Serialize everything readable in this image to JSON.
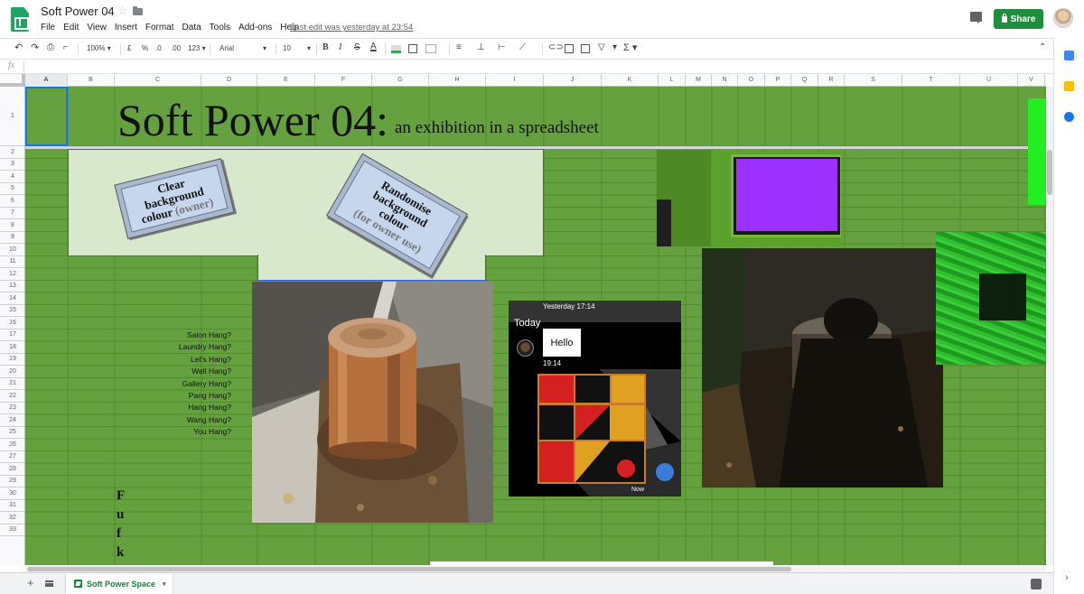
{
  "doc": {
    "title": "Soft Power 04",
    "menu": [
      "File",
      "Edit",
      "View",
      "Insert",
      "Format",
      "Data",
      "Tools",
      "Add-ons",
      "Help"
    ],
    "last_edit": "Last edit was yesterday at 23:54",
    "share_label": "Share"
  },
  "toolbar": {
    "zoom": "100%",
    "currency": "£",
    "percent": "%",
    "dec_less": ".0",
    "dec_more": ".00",
    "format_more": "123",
    "font": "Arial",
    "font_size": "10",
    "bold": "B",
    "italic": "I",
    "strike": "S",
    "text_color": "A"
  },
  "formula": {
    "fx": "fx"
  },
  "columns": [
    "A",
    "B",
    "C",
    "D",
    "E",
    "F",
    "G",
    "H",
    "I",
    "J",
    "K",
    "L",
    "M",
    "N",
    "O",
    "P",
    "Q",
    "R",
    "S",
    "T",
    "U",
    "V"
  ],
  "rows": [
    "1",
    "2",
    "3",
    "4",
    "5",
    "6",
    "7",
    "8",
    "9",
    "10",
    "11",
    "12",
    "13",
    "14",
    "15",
    "16",
    "17",
    "18",
    "19",
    "20",
    "21",
    "22",
    "23",
    "24",
    "25",
    "26",
    "27",
    "28",
    "29",
    "30",
    "31",
    "32",
    "33"
  ],
  "sheet": {
    "title_main": "Soft Power 04:",
    "title_sub": "an exhibition in a spreadsheet",
    "btn_clear": {
      "line1": "Clear",
      "line2": "background",
      "line3": "colour",
      "muted": "(owner)"
    },
    "btn_random": {
      "line1": "Randomise",
      "line2": "background",
      "line3": "colour",
      "muted": "(for owner use)"
    },
    "hang_list": [
      "Salon Hang?",
      "Laundry Hang?",
      "Let's Hang?",
      "Well Hang?",
      "Gallery Hang?",
      "Pang Hang?",
      "Hang Hang?",
      "Wang Hang?",
      "You Hang?"
    ],
    "fufk": [
      "F",
      "u",
      "f",
      "k"
    ],
    "phone": {
      "time": "Yesterday 17:14",
      "today": "Today",
      "msg": "Hello",
      "msg_time": "19:14",
      "now": "Now"
    }
  },
  "sheet_tab": {
    "name": "Soft Power Space"
  },
  "colors": {
    "cell_bg": "#65a23f",
    "grid_line": "#4f8a2c",
    "panel": "#d7e8cd",
    "selection": "#1a73e8",
    "share": "#1e8e3e",
    "bright_green": "#22ee22",
    "purple": "#9b30ff"
  }
}
